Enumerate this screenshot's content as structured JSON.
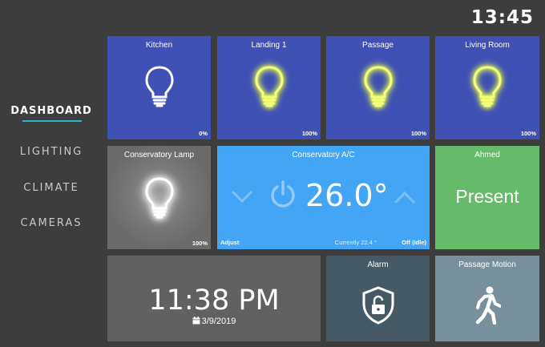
{
  "header": {
    "clock": "13:45"
  },
  "nav": {
    "items": [
      {
        "label": "DASHBOARD",
        "active": true
      },
      {
        "label": "LIGHTING"
      },
      {
        "label": "CLIMATE"
      },
      {
        "label": "CAMERAS"
      }
    ]
  },
  "tiles": {
    "kitchen": {
      "title": "Kitchen",
      "level": "0%"
    },
    "landing": {
      "title": "Landing 1",
      "level": "100%"
    },
    "passage": {
      "title": "Passage",
      "level": "100%"
    },
    "living_room": {
      "title": "Living Room",
      "level": "100%"
    },
    "conservatory_lamp": {
      "title": "Conservatory Lamp",
      "level": "100%"
    },
    "conservatory_ac": {
      "title": "Conservatory A/C",
      "setpoint": "26.0°",
      "adjust_label": "Adjust",
      "current": "Currently 22.4 °",
      "state": "Off (Idle)"
    },
    "ahmed": {
      "title": "Ahmed",
      "status": "Present"
    },
    "time": {
      "time": "11:38 PM",
      "date": "3/9/2019"
    },
    "alarm": {
      "title": "Alarm"
    },
    "passage_motion": {
      "title": "Passage Motion"
    }
  },
  "colors": {
    "background": "#3d3d3d",
    "light_tile": "#3f51b5",
    "ac_tile": "#42a5f5",
    "presence_tile": "#66bb6a",
    "time_tile": "#616161",
    "alarm_tile": "#455a64",
    "motion_tile": "#78909c",
    "nav_accent": "#1fb8d0",
    "bulb_on_glow": "#eeff41"
  }
}
